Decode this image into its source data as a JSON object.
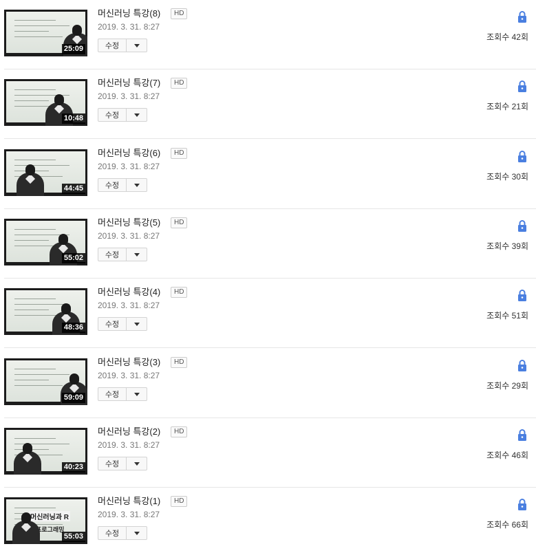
{
  "videos": [
    {
      "title": "머신러닝 특강(8)",
      "hd": "HD",
      "date": "2019. 3. 31. 8:27",
      "duration": "25:09",
      "edit_label": "수정",
      "views": "조회수 42회",
      "privacy_icon": "lock-icon"
    },
    {
      "title": "머신러닝 특강(7)",
      "hd": "HD",
      "date": "2019. 3. 31. 8:27",
      "duration": "10:48",
      "edit_label": "수정",
      "views": "조회수 21회",
      "privacy_icon": "lock-icon"
    },
    {
      "title": "머신러닝 특강(6)",
      "hd": "HD",
      "date": "2019. 3. 31. 8:27",
      "duration": "44:45",
      "edit_label": "수정",
      "views": "조회수 30회",
      "privacy_icon": "lock-icon"
    },
    {
      "title": "머신러닝 특강(5)",
      "hd": "HD",
      "date": "2019. 3. 31. 8:27",
      "duration": "55:02",
      "edit_label": "수정",
      "views": "조회수 39회",
      "privacy_icon": "lock-icon"
    },
    {
      "title": "머신러닝 특강(4)",
      "hd": "HD",
      "date": "2019. 3. 31. 8:27",
      "duration": "48:36",
      "edit_label": "수정",
      "views": "조회수 51회",
      "privacy_icon": "lock-icon"
    },
    {
      "title": "머신러닝 특강(3)",
      "hd": "HD",
      "date": "2019. 3. 31. 8:27",
      "duration": "59:09",
      "edit_label": "수정",
      "views": "조회수 29회",
      "privacy_icon": "lock-icon"
    },
    {
      "title": "머신러닝 특강(2)",
      "hd": "HD",
      "date": "2019. 3. 31. 8:27",
      "duration": "40:23",
      "edit_label": "수정",
      "views": "조회수 46회",
      "privacy_icon": "lock-icon"
    },
    {
      "title": "머신러닝 특강(1)",
      "hd": "HD",
      "date": "2019. 3. 31. 8:27",
      "duration": "55:03",
      "edit_label": "수정",
      "views": "조회수 66회",
      "privacy_icon": "lock-icon",
      "thumbnail_text": [
        "머신러닝과 R",
        "프로그래밍"
      ]
    }
  ],
  "colors": {
    "lock": "#4a7fe0",
    "divider": "#e6e6e6",
    "date_text": "#777777"
  }
}
